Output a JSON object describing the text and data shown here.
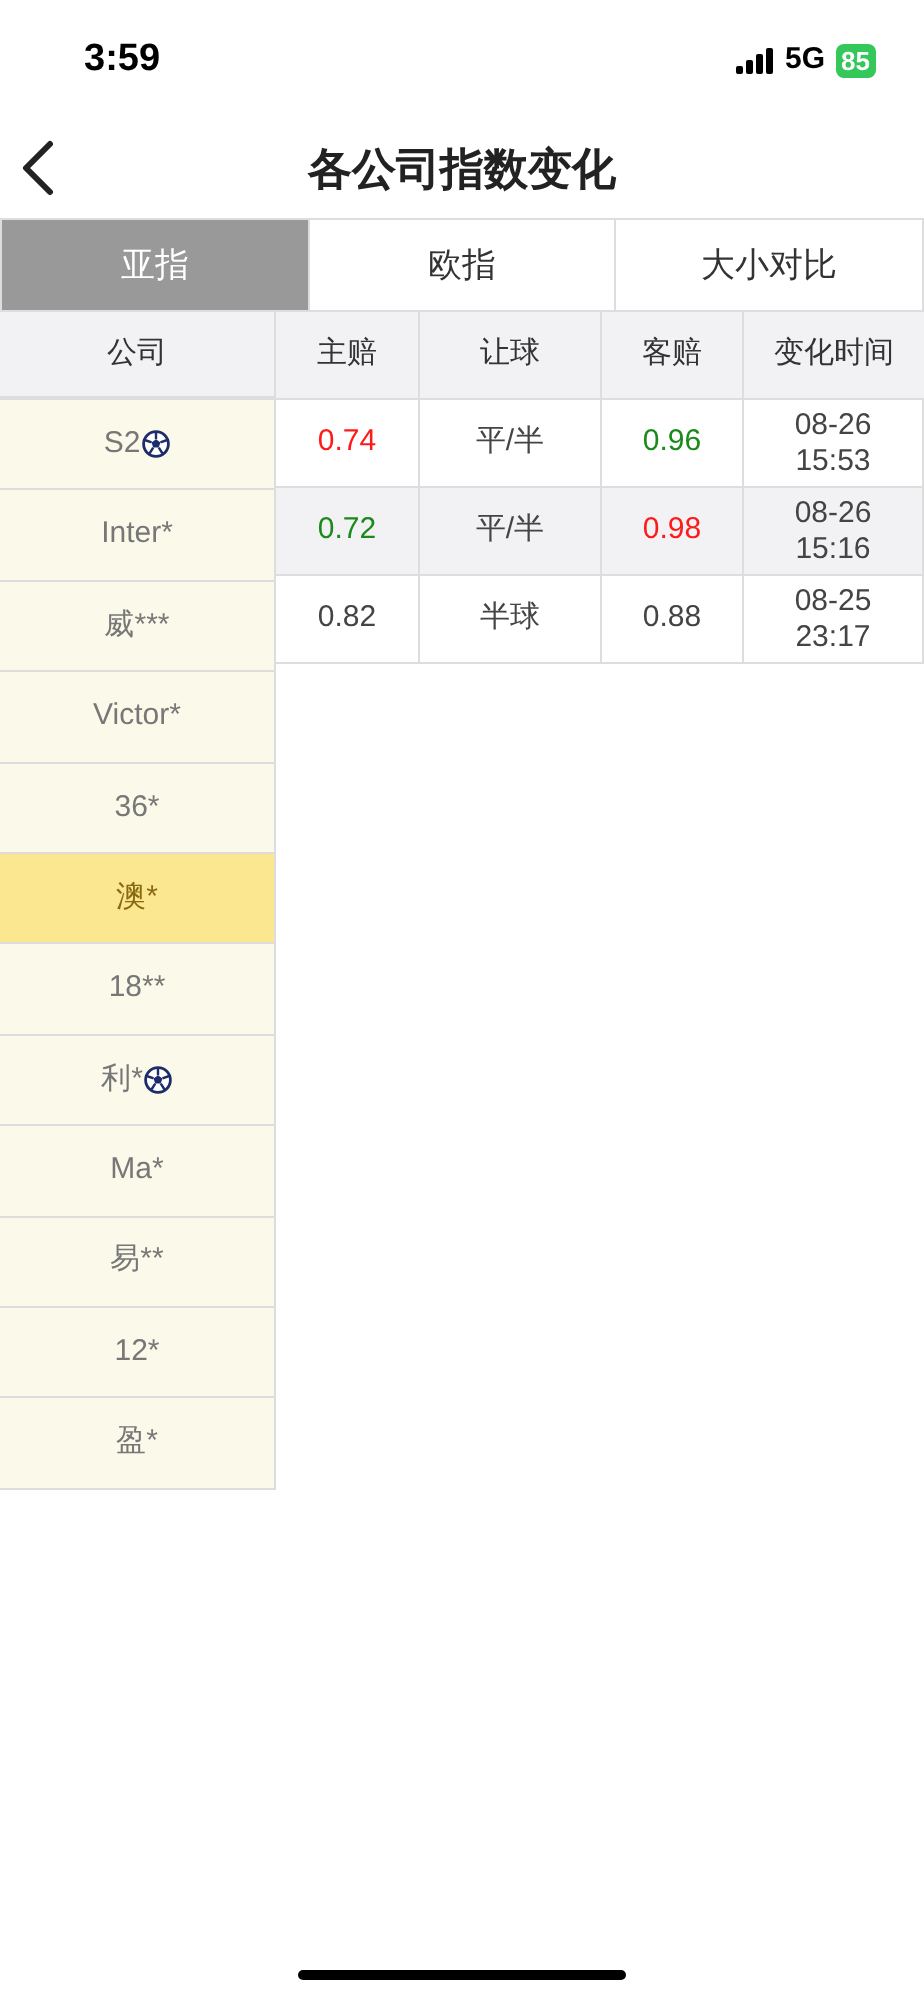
{
  "status_bar": {
    "time": "3:59",
    "network": "5G",
    "battery": "85"
  },
  "header": {
    "title": "各公司指数变化"
  },
  "tabs": [
    {
      "label": "亚指",
      "selected": true
    },
    {
      "label": "欧指",
      "selected": false
    },
    {
      "label": "大小对比",
      "selected": false
    }
  ],
  "table": {
    "columns": [
      "公司",
      "主赔",
      "让球",
      "客赔",
      "变化时间"
    ],
    "companies": [
      {
        "name": "S2",
        "ball": true,
        "selected": false
      },
      {
        "name": "Inter*",
        "ball": false,
        "selected": false
      },
      {
        "name": "威***",
        "ball": false,
        "selected": false
      },
      {
        "name": "Victor*",
        "ball": false,
        "selected": false
      },
      {
        "name": "36*",
        "ball": false,
        "selected": false
      },
      {
        "name": "澳*",
        "ball": false,
        "selected": true
      },
      {
        "name": "18**",
        "ball": false,
        "selected": false
      },
      {
        "name": "利*",
        "ball": true,
        "selected": false
      },
      {
        "name": "Ma*",
        "ball": false,
        "selected": false
      },
      {
        "name": "易**",
        "ball": false,
        "selected": false
      },
      {
        "name": "12*",
        "ball": false,
        "selected": false
      },
      {
        "name": "盈*",
        "ball": false,
        "selected": false
      }
    ],
    "rows": [
      {
        "home": {
          "value": "0.74",
          "color": "#ff1a1a"
        },
        "line": "平/半",
        "away": {
          "value": "0.96",
          "color": "#1a8a1a"
        },
        "date": "08-26",
        "time": "15:53"
      },
      {
        "home": {
          "value": "0.72",
          "color": "#1a8a1a"
        },
        "line": "平/半",
        "away": {
          "value": "0.98",
          "color": "#ff1a1a"
        },
        "date": "08-26",
        "time": "15:16"
      },
      {
        "home": {
          "value": "0.82",
          "color": "#444444"
        },
        "line": "半球",
        "away": {
          "value": "0.88",
          "color": "#444444"
        },
        "date": "08-25",
        "time": "23:17"
      }
    ]
  }
}
